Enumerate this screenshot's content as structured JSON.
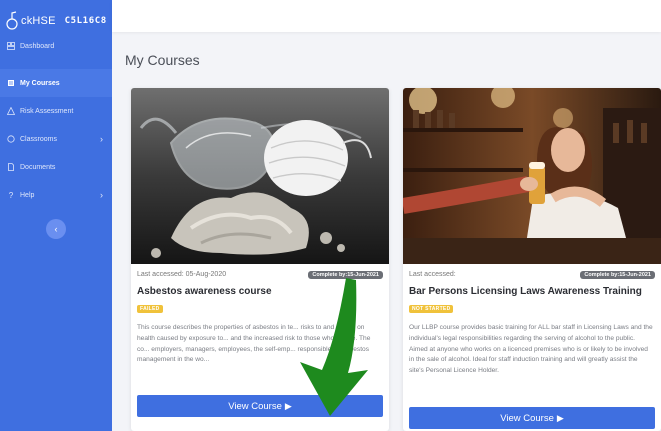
{
  "app": {
    "logo_text": "ckHSE",
    "user_code": "C5L16C8"
  },
  "sidebar": {
    "items": [
      {
        "label": "Dashboard",
        "icon": "dashboard-icon",
        "active": false
      },
      {
        "label": "My Courses",
        "icon": "courses-icon",
        "active": true
      },
      {
        "label": "Risk Assessment",
        "icon": "risk-icon",
        "active": false
      },
      {
        "label": "Classrooms",
        "icon": "classroom-icon",
        "active": false,
        "chevron": "›"
      },
      {
        "label": "Documents",
        "icon": "documents-icon",
        "active": false
      },
      {
        "label": "Help",
        "icon": "help-icon",
        "active": false,
        "chevron": "›"
      }
    ],
    "collapse_glyph": "‹"
  },
  "main": {
    "title": "My Courses"
  },
  "courses": [
    {
      "accessed": "Last accessed: 05-Aug-2020",
      "complete_by": "Complete by:15-Jun-2021",
      "title": "Asbestos awareness course",
      "status": "FAILED",
      "description": "This course describes the properties of asbestos in te... risks to and effects on health caused by exposure to... and the increased risk to those who smoke. The co... employers, managers, employees, the self-emp... responsible for asbestos management in the wo...",
      "button": "View Course",
      "play": "▶"
    },
    {
      "accessed": "Last accessed:",
      "complete_by": "Complete by:15-Jun-2021",
      "title": "Bar Persons Licensing Laws Awareness Training",
      "status": "NOT STARTED",
      "description": "Our LLBP course provides basic training for ALL bar staff in Licensing Laws and the individual's legal responsibilities regarding the serving of alcohol to the public. Aimed at anyone who works on a licenced premises who is or likely to be involved in the sale of alcohol. Ideal for staff induction training and will greatly assist the site's Personal Licence Holder.",
      "button": "View Course",
      "play": "▶"
    }
  ],
  "colors": {
    "sidebar": "#3f6fe0",
    "failed": "#f0c23b",
    "not_started": "#f0c23b",
    "arrow": "#1e8a1e"
  }
}
